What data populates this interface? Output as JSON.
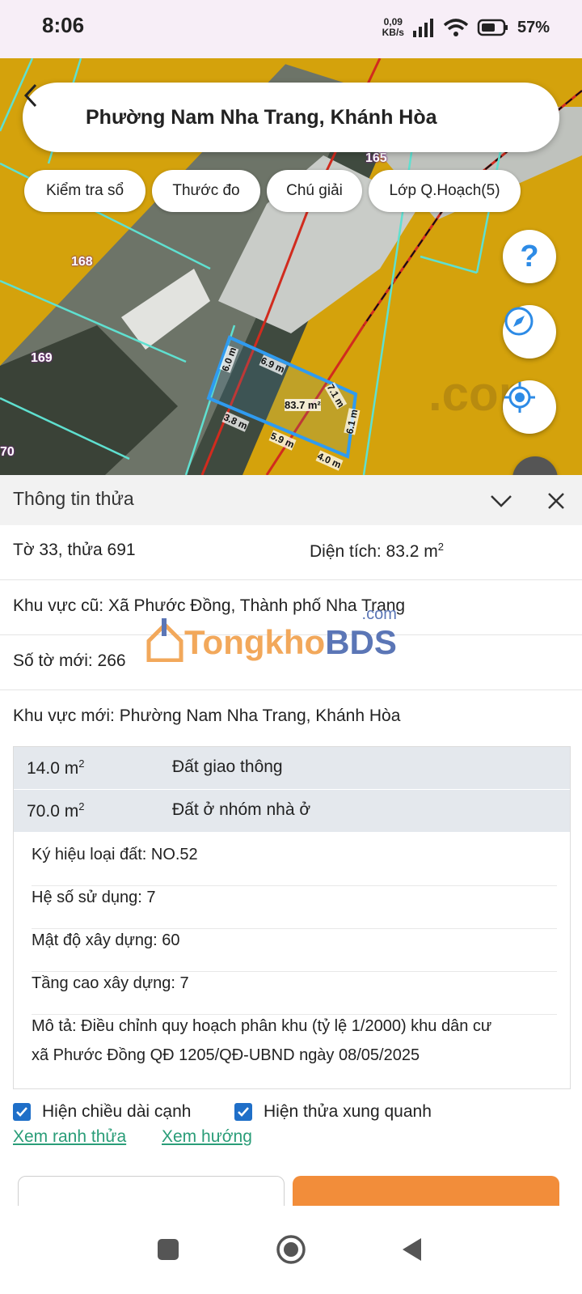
{
  "status": {
    "time": "8:06",
    "net_speed_value": "0,09",
    "net_speed_unit": "KB/s",
    "battery": "57%"
  },
  "map": {
    "title": "Phường Nam Nha Trang, Khánh Hòa",
    "chips": [
      "Kiểm tra sổ",
      "Thước đo",
      "Chú giải",
      "Lớp Q.Hoạch(5)"
    ],
    "parcel_numbers": [
      "165",
      "168",
      "169",
      "70"
    ],
    "edge_lengths": [
      "6.0 m",
      "6.9 m",
      "7.1 m",
      "6.1 m",
      "3.8 m",
      "5.9 m",
      "4.0 m"
    ],
    "parcel_area": "83.7 m²",
    "watermark_text": ".com",
    "colors": {
      "planning_yellow": "#d4a20c",
      "parcel_outline": "#2f9bf0",
      "boundary_cyan": "#5fe0d0"
    }
  },
  "sheet": {
    "title": "Thông tin thửa",
    "sheet_parcel": "Tờ 33, thửa 691",
    "area_label": "Diện tích: 83.2 m",
    "area_sup": "2",
    "old_area": "Khu vực cũ: Xã Phước Đồng, Thành phố Nha Trang",
    "new_sheet_no": "Số tờ mới: 266",
    "new_area": "Khu vực mới: Phường Nam Nha Trang, Khánh Hòa",
    "watermark": {
      "brand1": "Tongkho",
      "brand2": "BDS",
      "suffix": ".com"
    },
    "plan_rows": [
      {
        "area": "14.0 m",
        "sup": "2",
        "type": "Đất giao thông"
      },
      {
        "area": "70.0 m",
        "sup": "2",
        "type": "Đất ở nhóm nhà ở"
      }
    ],
    "attributes": [
      "Ký hiệu loại đất: NO.52",
      "Hệ số sử dụng: 7",
      "Mật độ xây dựng: 60",
      "Tầng cao xây dựng: 7"
    ],
    "description_line1": "Mô tả: Điều chỉnh quy hoạch phân khu (tỷ lệ 1/2000) khu dân cư",
    "description_line2": "xã Phước Đồng QĐ 1205/QĐ-UBND ngày 08/05/2025",
    "checkboxes": [
      {
        "label": "Hiện chiều dài cạnh",
        "checked": true
      },
      {
        "label": "Hiện thửa xung quanh",
        "checked": true
      }
    ],
    "links": [
      "Xem ranh thửa",
      "Xem hướng"
    ]
  }
}
